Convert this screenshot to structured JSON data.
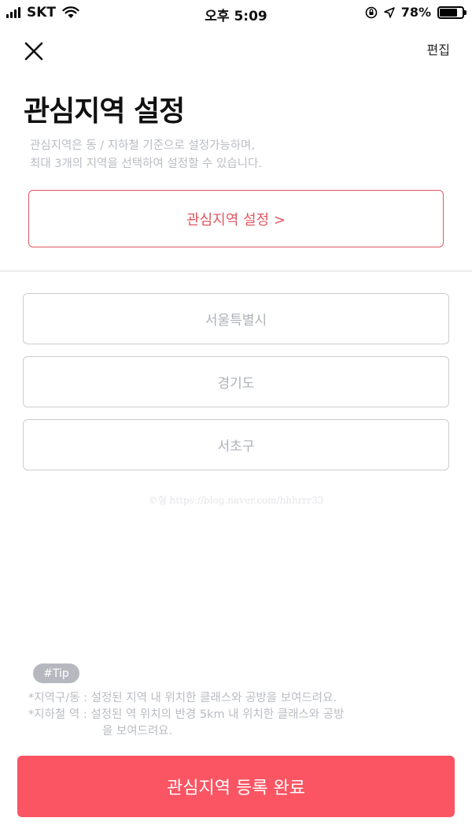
{
  "status_bar": {
    "carrier": "SKT",
    "time": "오후 5:09",
    "battery_percent": "78%",
    "battery_level": 0.78,
    "icons": [
      "signal-icon",
      "wifi-icon",
      "orientation-lock-icon",
      "location-arrow-icon",
      "battery-icon"
    ]
  },
  "header": {
    "close_icon": "close-icon",
    "edit_label": "편집",
    "title": "관심지역 설정",
    "description_line1": "관심지역은 동 / 지하철 기준으로 설정가능하며,",
    "description_line2": "최대 3개의 지역을 선택하여 설정할 수 있습니다."
  },
  "setting_button": {
    "label": "관심지역 설정 >"
  },
  "regions": [
    {
      "label": "서울특별시"
    },
    {
      "label": "경기도"
    },
    {
      "label": "서초구"
    }
  ],
  "watermark": "©형  https://blog.naver.com/hhhrrr33",
  "tip": {
    "badge": "#Tip",
    "line1": "*지역구/동 : 설정된 지역 내 위치한 클래스와 공방을 보여드려요.",
    "line2": "*지하철 역 : 설정된 역 위치의 반경 5km 내 위치한 클래스와 공방",
    "line3": "을 보여드려요."
  },
  "submit_button": {
    "label": "관심지역 등록 완료"
  },
  "colors": {
    "accent": "#fb5563",
    "accent_outline": "#e15761",
    "muted_text": "#b9bcc2",
    "border": "#c9cdd2"
  }
}
